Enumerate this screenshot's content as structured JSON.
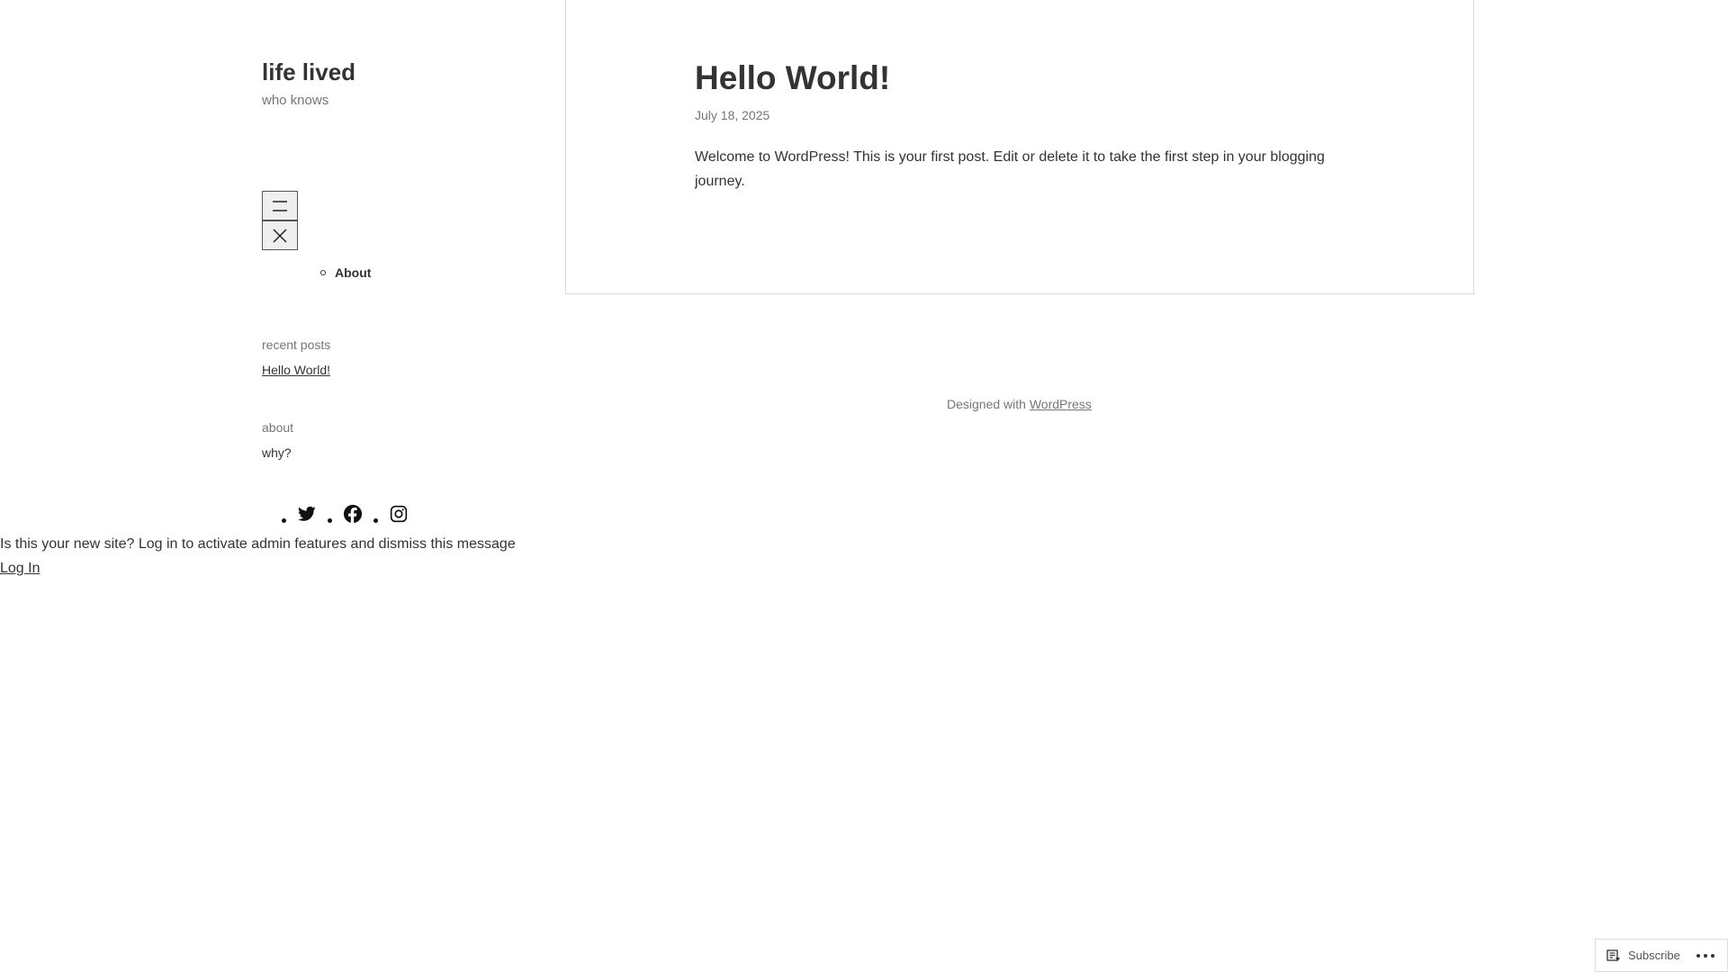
{
  "site": {
    "title": "life lived",
    "tagline": "who knows"
  },
  "nav": {
    "items": [
      {
        "label": "About"
      }
    ]
  },
  "widgets": {
    "recent_posts_title": "recent posts",
    "recent_posts": [
      "Hello World!"
    ],
    "about_title": "about",
    "about_text": "why?"
  },
  "social": {
    "icons": [
      "twitter-icon",
      "facebook-icon",
      "instagram-icon"
    ]
  },
  "post": {
    "title": "Hello World!",
    "date": "July 18, 2025",
    "body": "Welcome to WordPress! This is your first post. Edit or delete it to take the first step in your blogging journey."
  },
  "footer": {
    "prefix": "Designed with",
    "link": "WordPress"
  },
  "admin_notice": {
    "message": "Is this your new site? Log in to activate admin features and dismiss this message",
    "login_label": "Log In"
  },
  "subscribe": {
    "label": "Subscribe"
  }
}
